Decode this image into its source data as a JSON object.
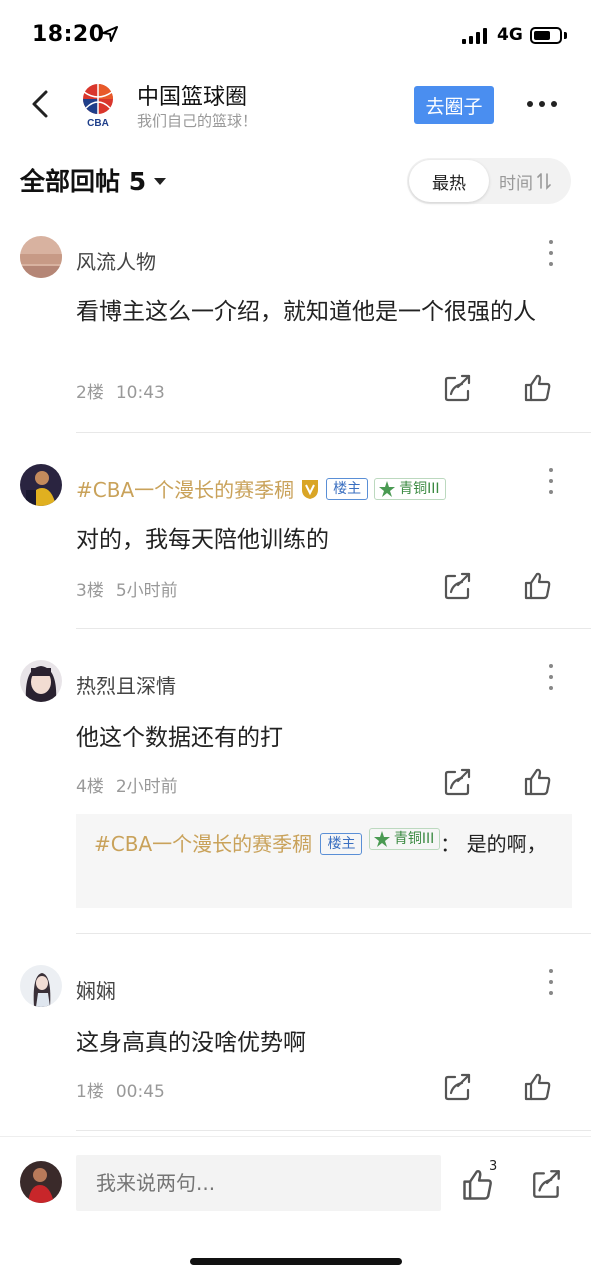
{
  "status": {
    "time": "18:20",
    "network": "4G"
  },
  "header": {
    "circle_name": "中国篮球圈",
    "circle_sub": "我们自己的篮球！",
    "go_button": "去圈子",
    "logo_text": "CBA"
  },
  "sort": {
    "replies_label": "全部回帖 5",
    "hot_label": "最热",
    "time_label": "时间"
  },
  "posts": [
    {
      "username": "风流人物",
      "content": "看博主这么一介绍，就知道他是一个很强的人",
      "floor": "2楼",
      "time": "10:43"
    },
    {
      "username": "#CBA一个漫长的赛季稠",
      "owner_badge": "楼主",
      "level_badge": "青铜III",
      "content": "对的，我每天陪他训练的",
      "floor": "3楼",
      "time": "5小时前"
    },
    {
      "username": "热烈且深情",
      "content": "他这个数据还有的打",
      "floor": "4楼",
      "time": "2小时前",
      "reply": {
        "username": "#CBA一个漫长的赛季稠",
        "owner_badge": "楼主",
        "level_badge": "青铜III",
        "text": "：  是的啊，"
      }
    },
    {
      "username": "娴娴",
      "content": "这身高真的没啥优势啊",
      "floor": "1楼",
      "time": "00:45"
    }
  ],
  "bottom": {
    "placeholder": "我来说两句...",
    "like_count": "3"
  },
  "colors": {
    "accent": "#4a8ef0",
    "gold_name": "#c9a25a",
    "owner_badge": "#3a6fc0",
    "level_badge": "#3b8a42"
  }
}
